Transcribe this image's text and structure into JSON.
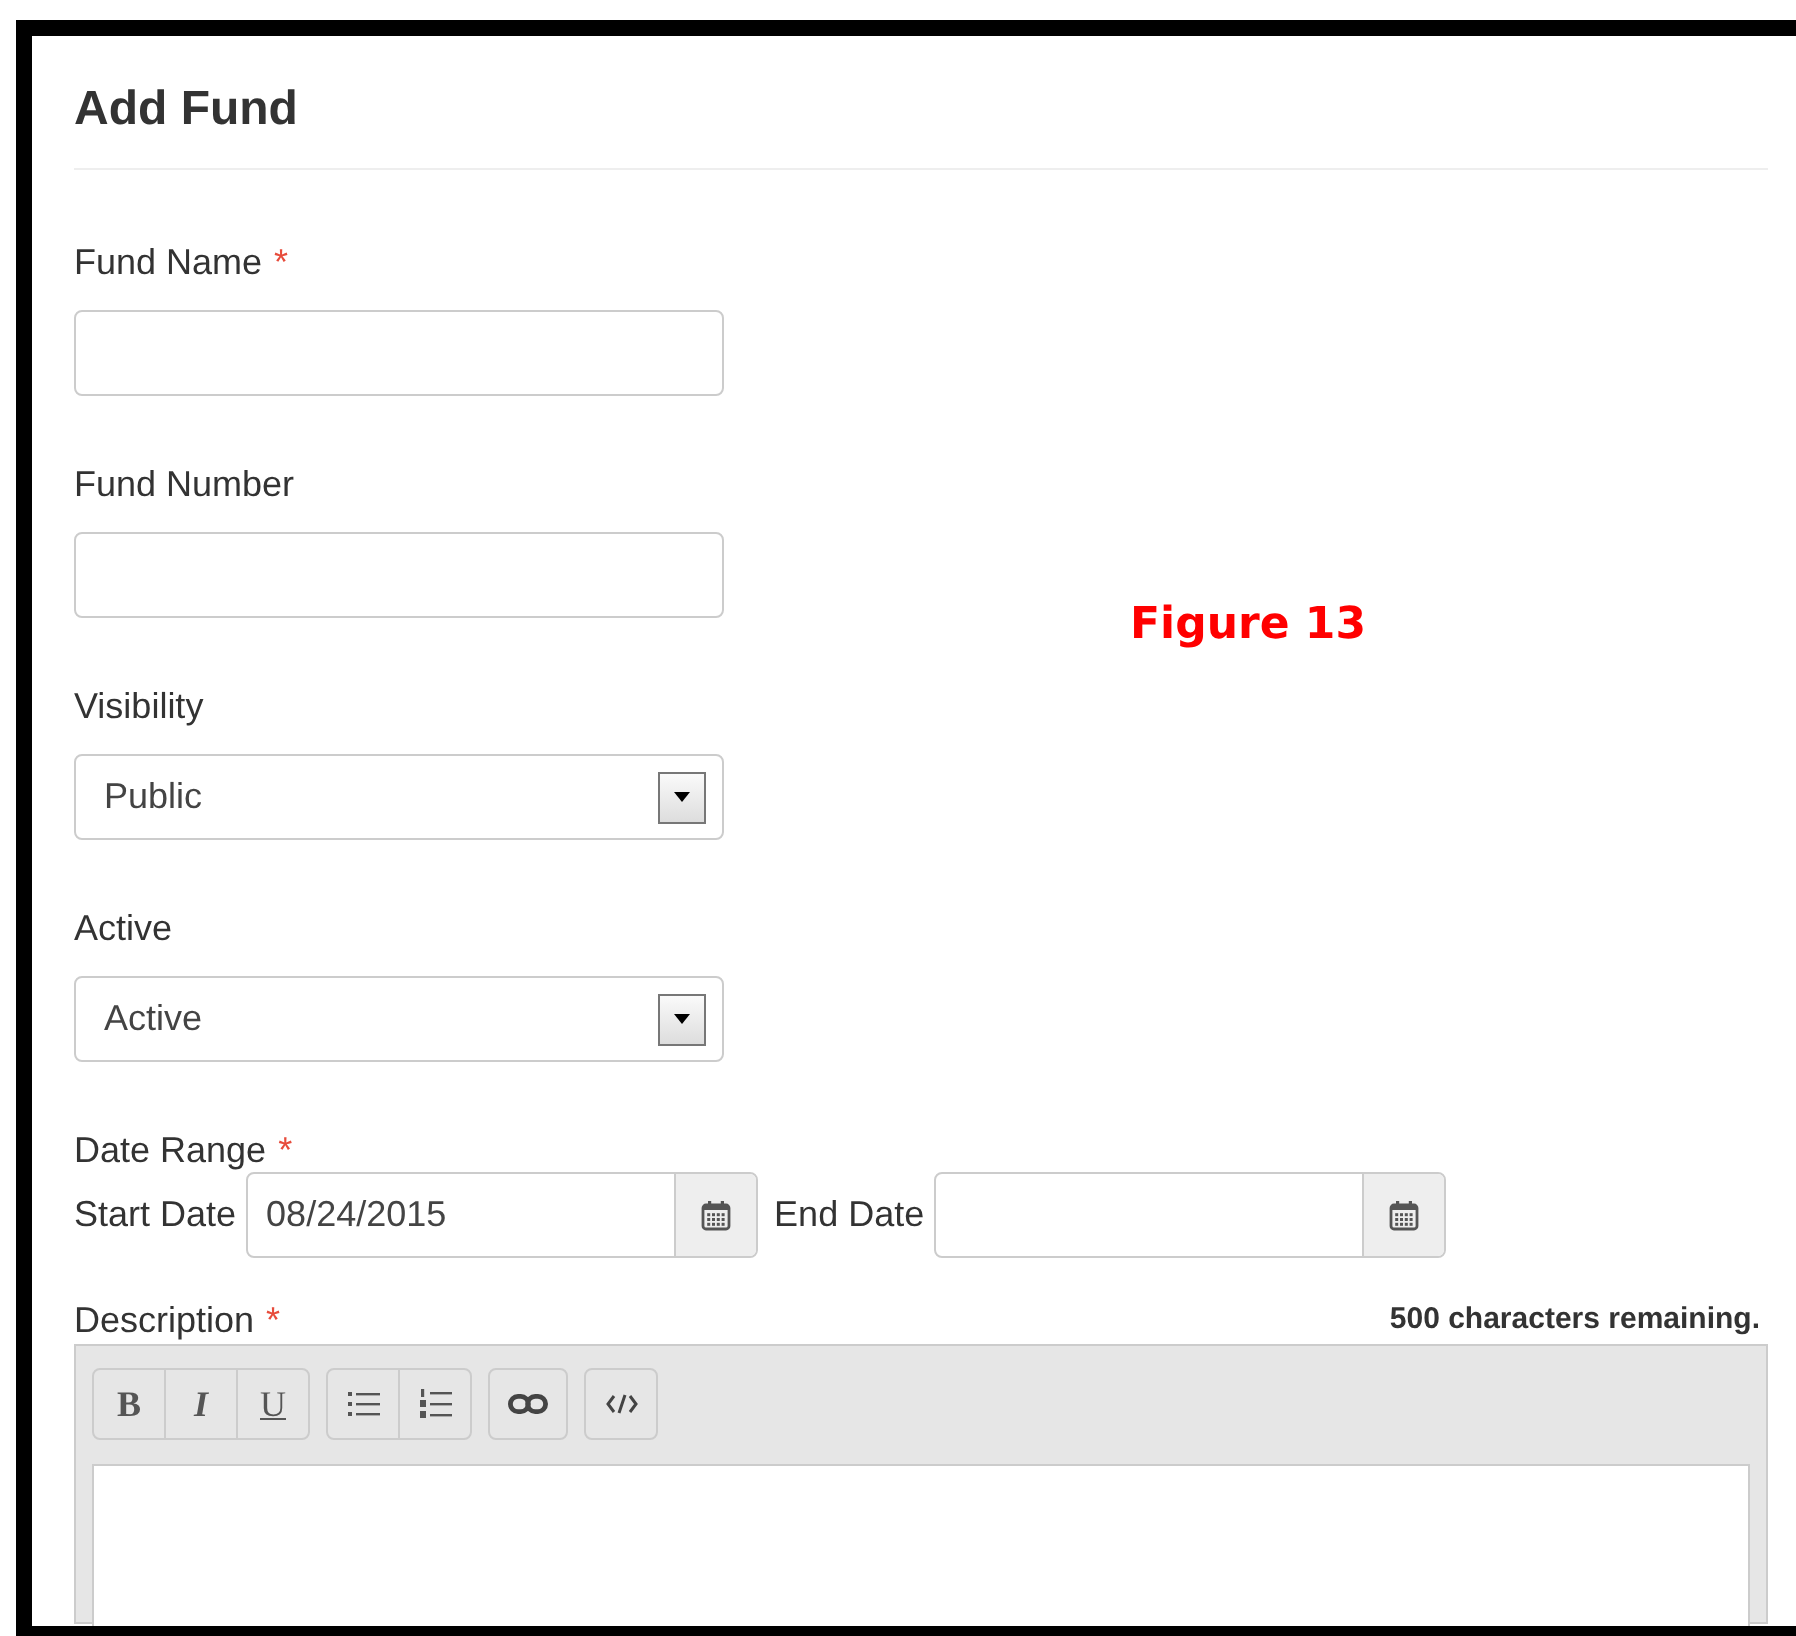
{
  "title": "Add Fund",
  "annotation": "Figure 13",
  "fields": [
    {
      "kind": "text",
      "label": "Fund Name",
      "required_mark": "*"
    },
    {
      "kind": "text",
      "label": "Fund Number"
    },
    {
      "kind": "select",
      "label": "Visibility",
      "value": "Public"
    },
    {
      "kind": "select",
      "label": "Active",
      "value": "Active"
    },
    {
      "kind": "daterange",
      "label": "Date Range",
      "required_mark": "*",
      "start_label": "Start Date",
      "start_value": "08/24/2015",
      "end_label": "End Date"
    },
    {
      "kind": "editor",
      "label": "Description",
      "required_mark": "*",
      "counter": "500 characters remaining.",
      "toolbar": [
        [
          {
            "kind": "bold",
            "label": "B"
          },
          {
            "kind": "italic",
            "label": "I"
          },
          {
            "kind": "underline",
            "label": "U"
          }
        ],
        [
          {
            "kind": "bullets"
          },
          {
            "kind": "numbers"
          }
        ],
        [
          {
            "kind": "link"
          }
        ],
        [
          {
            "kind": "code"
          }
        ]
      ]
    }
  ]
}
